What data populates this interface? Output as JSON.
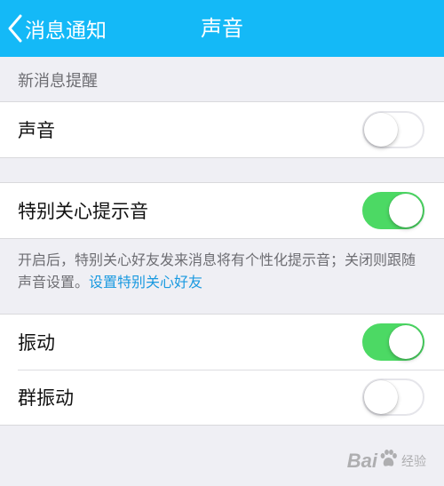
{
  "nav": {
    "back_label": "消息通知",
    "title": "声音",
    "back_icon": "chevron-left-icon",
    "background_color": "#14b9f7"
  },
  "section": {
    "header": "新消息提醒"
  },
  "rows": {
    "sound": {
      "label": "声音",
      "enabled": false
    },
    "special_tone": {
      "label": "特别关心提示音",
      "enabled": true
    },
    "vibrate": {
      "label": "振动",
      "enabled": true
    },
    "group_vibrate": {
      "label": "群振动",
      "enabled": false
    }
  },
  "note": {
    "text": "开启后，特别关心好友发来消息将有个性化提示音；关闭则跟随声音设置。",
    "link": "设置特别关心好友"
  },
  "colors": {
    "toggle_on": "#4cd964",
    "link": "#1a9ae0"
  },
  "watermark": {
    "left": "Bai",
    "right": "经验"
  }
}
